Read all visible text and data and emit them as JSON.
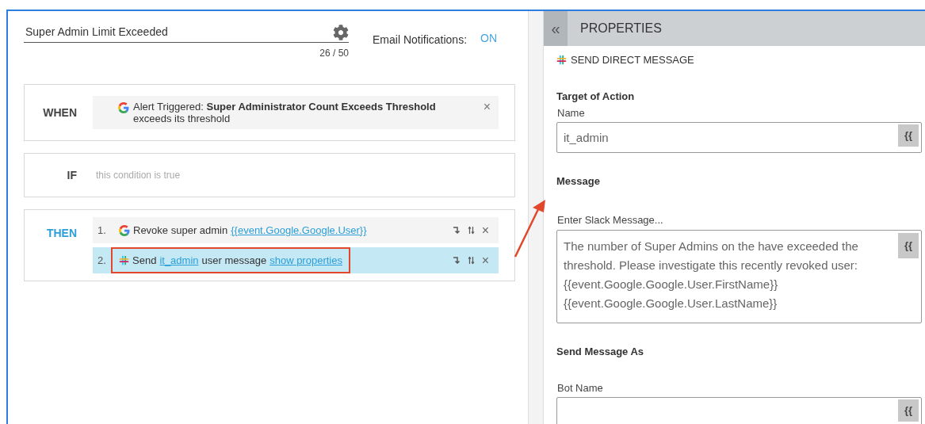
{
  "rule": {
    "title": "Super Admin Limit Exceeded",
    "counter": "26 / 50",
    "email_label": "Email Notifications:",
    "email_state": "ON"
  },
  "when": {
    "label": "WHEN",
    "kind": "google",
    "prefix": "Alert Triggered:",
    "alert": "Super Administrator Count Exceeds Threshold",
    "detail": "exceeds its threshold",
    "remove": "×"
  },
  "if": {
    "label": "IF",
    "placeholder": "this condition is true"
  },
  "then": {
    "label": "THEN",
    "steps": [
      {
        "number": "1.",
        "kind": "google",
        "selected": false,
        "annotated": false,
        "parts": [
          {
            "text": "Revoke super admin",
            "kind": "text"
          },
          {
            "text": "{{event.Google.Google.User}}",
            "kind": "link"
          }
        ],
        "remove": "×"
      },
      {
        "number": "2.",
        "kind": "slack",
        "selected": true,
        "annotated": true,
        "parts": [
          {
            "text": "Send",
            "kind": "text"
          },
          {
            "text": "it_admin",
            "kind": "link"
          },
          {
            "text": "user message",
            "kind": "text"
          },
          {
            "text": "show properties",
            "kind": "link"
          }
        ],
        "remove": "×"
      }
    ]
  },
  "properties": {
    "collapse": "«",
    "title": "PROPERTIES",
    "action": "SEND DIRECT MESSAGE",
    "sections": [
      {
        "heading": "Target of Action",
        "fields": [
          {
            "label": "Name",
            "value": "it_admin",
            "kind": "input",
            "insert": "{{"
          }
        ]
      },
      {
        "heading": "Message",
        "fields": [
          {
            "label": "Enter Slack Message...",
            "value": "The number of Super Admins on the have exceeded the threshold. Please investigate this recently revoked user: {{event.Google.Google.User.FirstName}} {{event.Google.Google.User.LastName}}",
            "kind": "textarea",
            "insert": "{{"
          }
        ]
      },
      {
        "heading": "Send Message As",
        "fields": [
          {
            "label": "Bot Name",
            "kind": "input",
            "insert": "{{"
          }
        ]
      }
    ]
  }
}
